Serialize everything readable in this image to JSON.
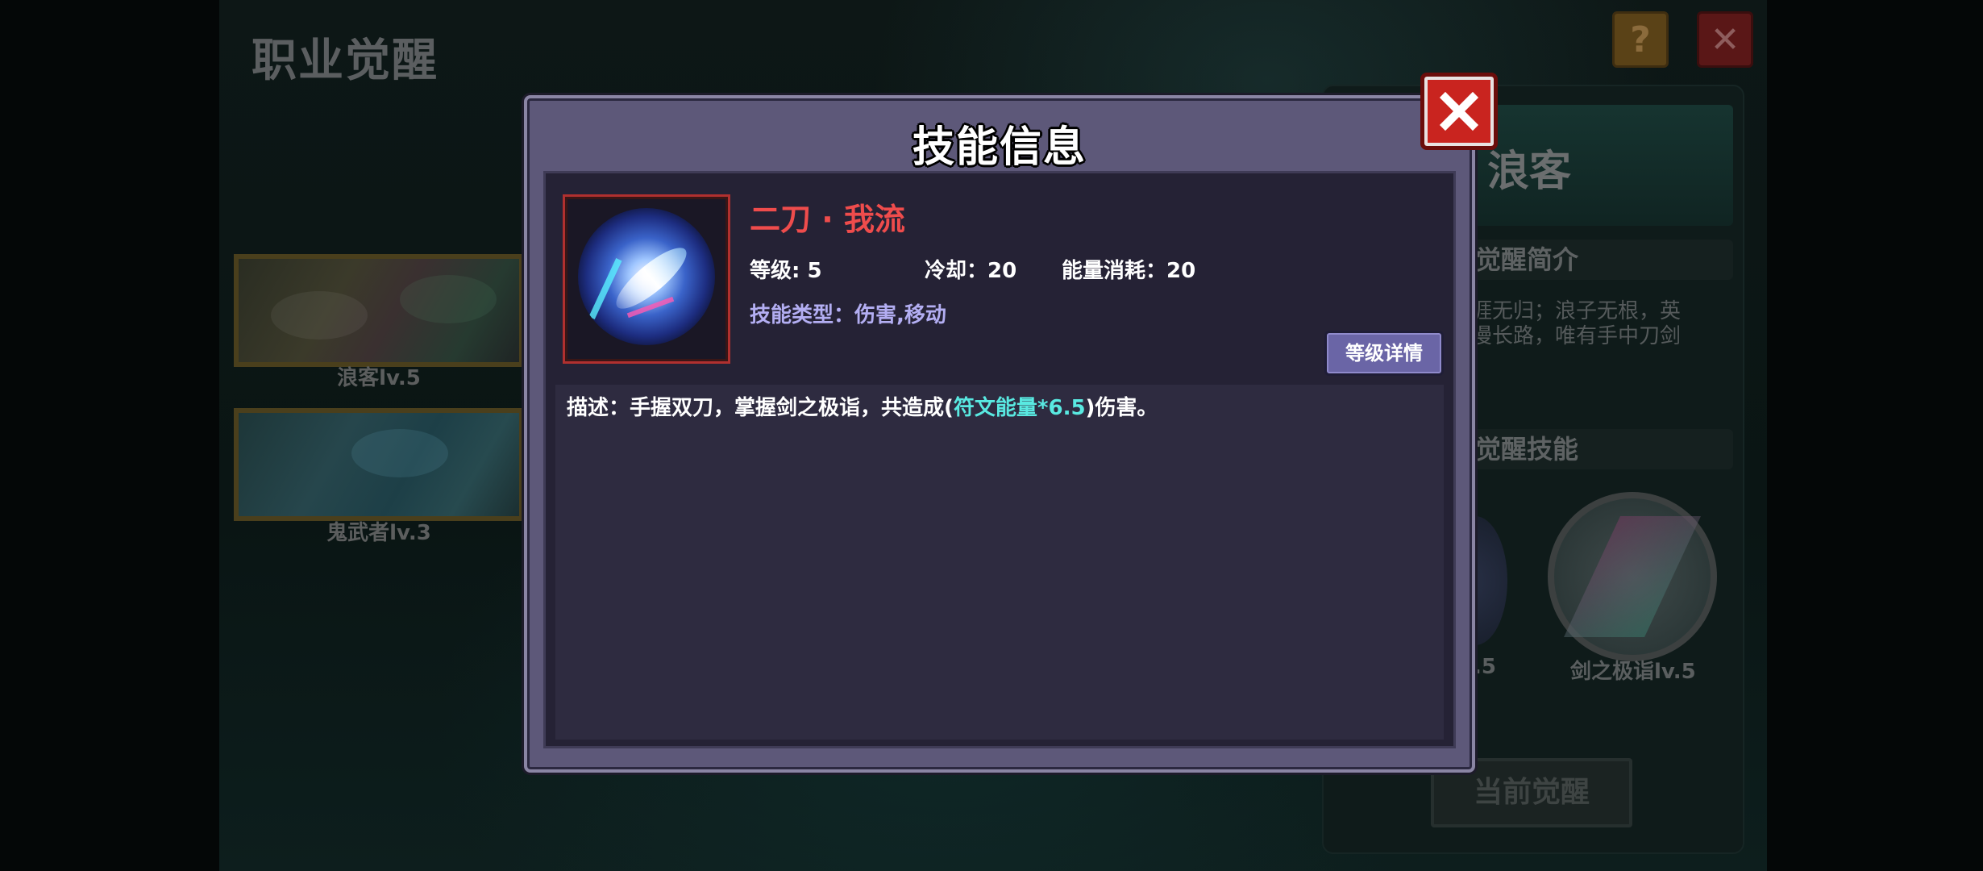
{
  "background": {
    "title": "职业觉醒",
    "help_icon": "?",
    "close_icon": "✕",
    "classes": [
      {
        "label": "浪客lv.5"
      },
      {
        "label": "鬼武者lv.3"
      }
    ],
    "right_panel": {
      "name": "浪客",
      "intro_title": "觉醒简介",
      "intro_line1": "涯无归；浪子无根，英",
      "intro_line2": "漫长路，唯有手中刀剑",
      "skill_title": "觉醒技能",
      "skill_a_label": ".5",
      "skill_b_label": "剑之极诣lv.5",
      "current_button": "当前觉醒"
    }
  },
  "modal": {
    "title": "技能信息",
    "skill_name": "二刀 · 我流",
    "level": "等级: 5",
    "cooldown": "冷却：20",
    "energy": "能量消耗：20",
    "skill_type": "技能类型：伤害,移动",
    "level_detail_button": "等级详情",
    "description_prefix": "描述：手握双刀，掌握剑之极诣，共造成(",
    "description_highlight": "符文能量*6.5",
    "description_suffix": ")伤害。",
    "close_icon": "close-icon"
  },
  "colors": {
    "skill_name": "#ef4c4c",
    "skill_type": "#b3aef2",
    "highlight": "#59e9e1",
    "modal_frame": "#5d5879",
    "close_button": "#c9241f"
  }
}
